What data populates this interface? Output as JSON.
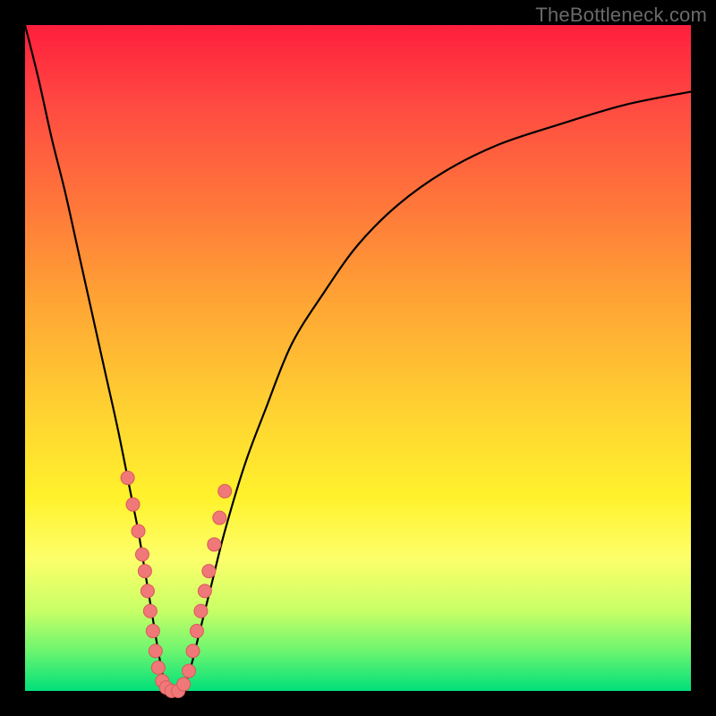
{
  "watermark": {
    "text": "TheBottleneck.com"
  },
  "colors": {
    "frame": "#000000",
    "curve": "#000000",
    "marker_fill": "#f07878",
    "marker_stroke": "#d95a5a",
    "gradient_top": "#ff1e3c",
    "gradient_bottom": "#00e07a"
  },
  "chart_data": {
    "type": "line",
    "title": "",
    "xlabel": "",
    "ylabel": "",
    "xlim": [
      0,
      100
    ],
    "ylim": [
      0,
      100
    ],
    "grid": false,
    "series": [
      {
        "name": "bottleneck-curve",
        "x": [
          0,
          2,
          4,
          6,
          8,
          10,
          12,
          14,
          16,
          17,
          18,
          19,
          20,
          21,
          22,
          23,
          24,
          25,
          26,
          28,
          30,
          33,
          36,
          40,
          45,
          50,
          56,
          63,
          71,
          80,
          90,
          100
        ],
        "y": [
          100,
          92,
          83,
          75,
          66,
          57,
          48,
          39,
          29,
          24,
          18,
          12,
          6,
          1,
          0,
          0,
          1,
          4,
          8,
          16,
          24,
          34,
          42,
          52,
          60,
          67,
          73,
          78,
          82,
          85,
          88,
          90
        ]
      }
    ],
    "markers": {
      "name": "highlighted-points",
      "x": [
        15.4,
        16.2,
        17.0,
        17.6,
        18.0,
        18.4,
        18.8,
        19.2,
        19.6,
        20.0,
        20.6,
        21.2,
        22.0,
        23.0,
        23.8,
        24.6,
        25.2,
        25.8,
        26.4,
        27.0,
        27.6,
        28.4,
        29.2,
        30.0
      ],
      "y": [
        32,
        28,
        24,
        20.5,
        18,
        15,
        12,
        9,
        6,
        3.5,
        1.5,
        0.5,
        0,
        0,
        1,
        3,
        6,
        9,
        12,
        15,
        18,
        22,
        26,
        30
      ]
    }
  }
}
